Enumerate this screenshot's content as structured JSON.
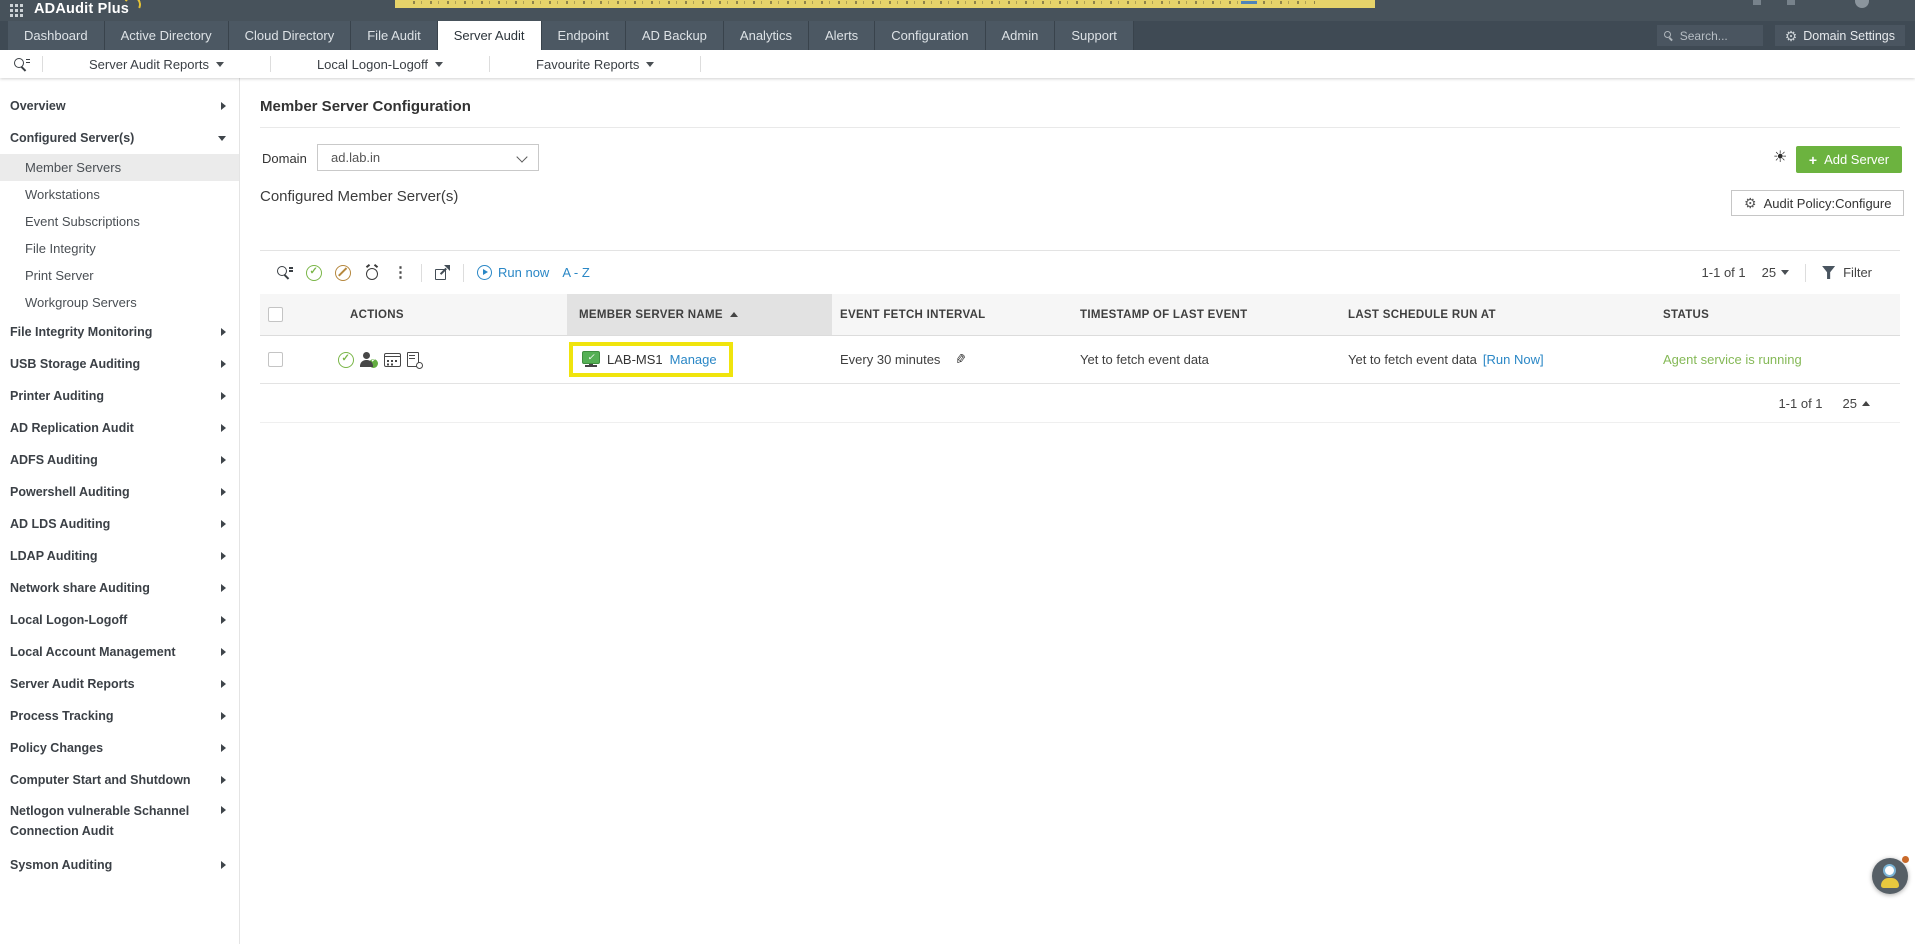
{
  "colors": {
    "accent_green": "#6cb33f",
    "link_blue": "#2a87c6",
    "highlight_yellow": "#f0e40d",
    "status_green": "#85b957",
    "banner_yellow": "#e6d36a",
    "header_dark": "#47525b"
  },
  "topbar": {
    "logo": "ADAudit Plus"
  },
  "navbar": {
    "tabs": [
      "Dashboard",
      "Active Directory",
      "Cloud Directory",
      "File Audit",
      "Server Audit",
      "Endpoint",
      "AD Backup",
      "Analytics",
      "Alerts",
      "Configuration",
      "Admin",
      "Support"
    ],
    "active_tab": "Server Audit",
    "search_placeholder": "Search...",
    "domain_settings_label": "Domain Settings"
  },
  "reports_bar": {
    "menus": [
      "Server Audit Reports",
      "Local Logon-Logoff",
      "Favourite Reports"
    ]
  },
  "sidebar": {
    "items": [
      {
        "label": "Overview"
      },
      {
        "label": "Configured Server(s)"
      },
      {
        "label": "Member Servers"
      },
      {
        "label": "Workstations"
      },
      {
        "label": "Event Subscriptions"
      },
      {
        "label": "File Integrity"
      },
      {
        "label": "Print Server"
      },
      {
        "label": "Workgroup Servers"
      },
      {
        "label": "File Integrity Monitoring"
      },
      {
        "label": "USB Storage Auditing"
      },
      {
        "label": "Printer Auditing"
      },
      {
        "label": "AD Replication Audit"
      },
      {
        "label": "ADFS Auditing"
      },
      {
        "label": "Powershell Auditing"
      },
      {
        "label": "AD LDS Auditing"
      },
      {
        "label": "LDAP Auditing"
      },
      {
        "label": "Network share Auditing"
      },
      {
        "label": "Local Logon-Logoff"
      },
      {
        "label": "Local Account Management"
      },
      {
        "label": "Server Audit Reports"
      },
      {
        "label": "Process Tracking"
      },
      {
        "label": "Policy Changes"
      },
      {
        "label": "Computer Start and Shutdown"
      },
      {
        "label": "Netlogon vulnerable Schannel Connection Audit"
      },
      {
        "label": "Sysmon Auditing"
      }
    ]
  },
  "main": {
    "page_title": "Member Server Configuration",
    "domain_label": "Domain",
    "domain_value": "ad.lab.in",
    "add_server_label": "Add Server",
    "section_title": "Configured Member Server(s)",
    "audit_policy_label": "Audit Policy:Configure",
    "table": {
      "run_now_label": "Run now",
      "sort_label": "A - Z",
      "page_info": "1-1 of 1",
      "page_size": "25",
      "filter_label": "Filter",
      "columns": [
        "ACTIONS",
        "MEMBER SERVER NAME",
        "EVENT FETCH INTERVAL",
        "TIMESTAMP OF LAST EVENT",
        "LAST SCHEDULE RUN AT",
        "STATUS"
      ],
      "row": {
        "server_name": "LAB-MS1",
        "manage_label": "Manage",
        "fetch_interval": "Every 30 minutes",
        "timestamp_last_event": "Yet to fetch event data",
        "last_schedule_run": "Yet to fetch event data",
        "run_now_link": "[Run Now]",
        "status": "Agent service is running"
      },
      "footer": {
        "page_info": "1-1 of 1",
        "page_size": "25"
      }
    }
  }
}
